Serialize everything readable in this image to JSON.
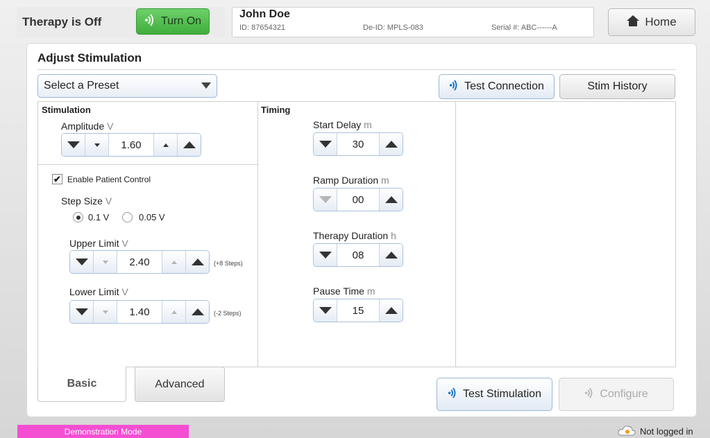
{
  "header": {
    "therapy_status": "Therapy is Off",
    "turn_on_label": "Turn On",
    "patient": {
      "name": "John Doe",
      "id": "ID: 87654321",
      "deid": "De-ID: MPLS-083",
      "serial": "Serial #: ABC------A"
    },
    "home_label": "Home"
  },
  "main": {
    "title": "Adjust Stimulation",
    "preset_placeholder": "Select a Preset",
    "test_connection_label": "Test Connection",
    "stim_history_label": "Stim History"
  },
  "stimulation": {
    "section_title": "Stimulation",
    "amplitude": {
      "label": "Amplitude",
      "unit": "V",
      "value": "1.60"
    },
    "enable_patient_control": {
      "label": "Enable Patient Control",
      "checked": true
    },
    "step_size": {
      "label": "Step Size",
      "unit": "V",
      "options": [
        "0.1 V",
        "0.05 V"
      ],
      "selected": "0.1 V"
    },
    "upper_limit": {
      "label": "Upper Limit",
      "unit": "V",
      "value": "2.40",
      "note": "(+8 Steps)"
    },
    "lower_limit": {
      "label": "Lower Limit",
      "unit": "V",
      "value": "1.40",
      "note": "(-2 Steps)"
    }
  },
  "timing": {
    "section_title": "Timing",
    "start_delay": {
      "label": "Start Delay",
      "unit": "m",
      "value": "30"
    },
    "ramp_duration": {
      "label": "Ramp Duration",
      "unit": "m",
      "value": "00"
    },
    "therapy_duration": {
      "label": "Therapy Duration",
      "unit": "h",
      "value": "08"
    },
    "pause_time": {
      "label": "Pause Time",
      "unit": "m",
      "value": "15"
    }
  },
  "tabs": {
    "basic": "Basic",
    "advanced": "Advanced",
    "active": "Basic"
  },
  "actions": {
    "test_stimulation": "Test Stimulation",
    "configure": "Configure"
  },
  "footer": {
    "mode": "Demonstration Mode",
    "login_status": "Not logged in"
  },
  "colors": {
    "turn_on_green": "#3fae3c",
    "accent_blue": "#1a73c8",
    "demo_pink": "#f44ed3"
  },
  "icons": {
    "wireless": "wireless-signal-icon",
    "home": "home-icon",
    "dropdown": "chevron-down-icon",
    "user": "user-cloud-icon"
  }
}
